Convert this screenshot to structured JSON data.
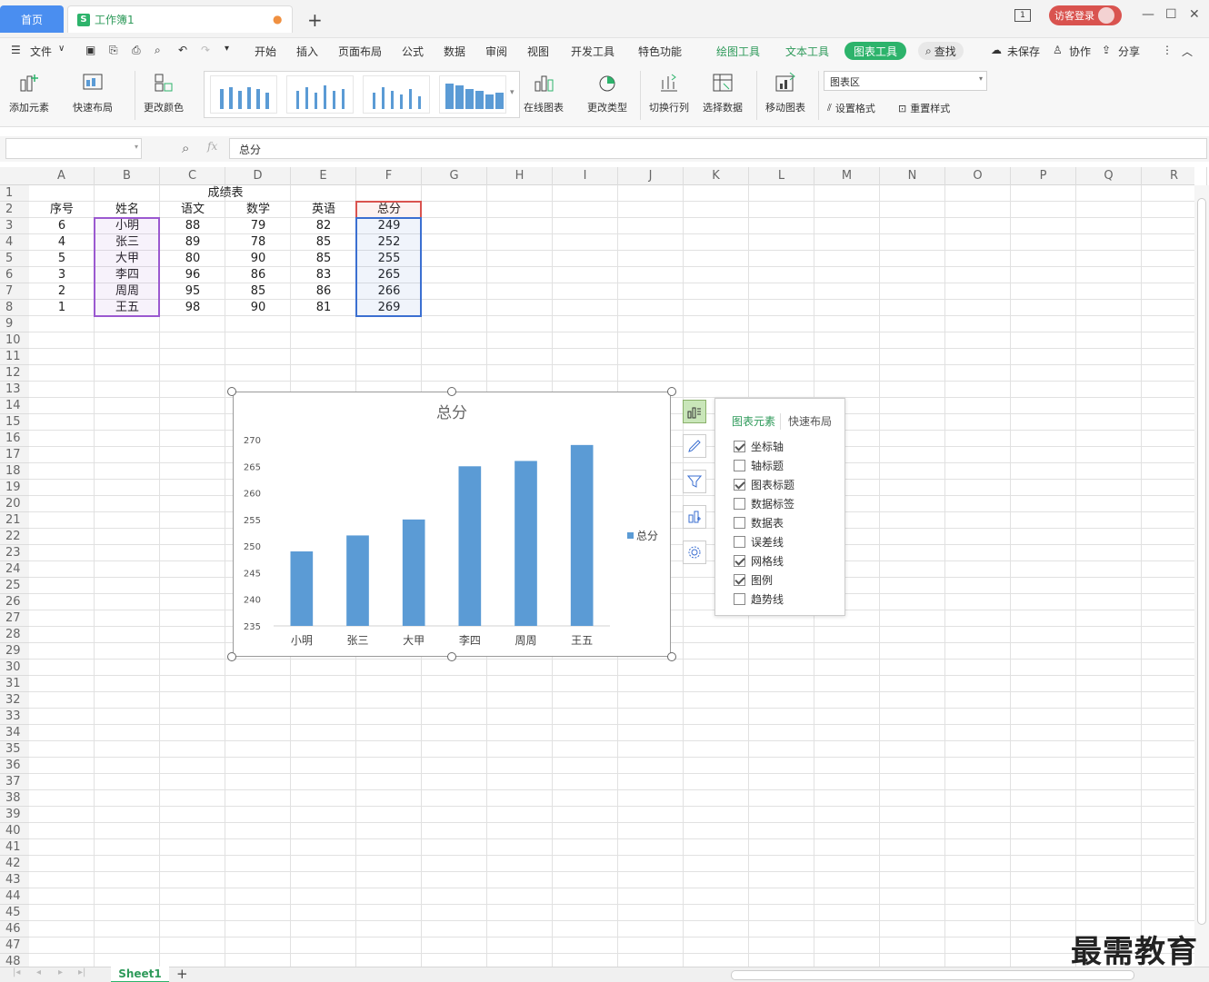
{
  "titlebar": {
    "home_tab": "首页",
    "doc_tab": "工作簿1",
    "doc_icon": "S",
    "modified_dot": "●",
    "new_tab": "+",
    "page_badge": "1",
    "login": "访客登录"
  },
  "menu": {
    "file": "文件",
    "items": [
      "开始",
      "插入",
      "页面布局",
      "公式",
      "数据",
      "审阅",
      "视图",
      "开发工具",
      "特色功能"
    ],
    "draw_tools": "绘图工具",
    "text_tools": "文本工具",
    "chart_tools": "图表工具",
    "search": "查找",
    "unsaved": "未保存",
    "collab": "协作",
    "share": "分享"
  },
  "ribbon": {
    "add_element": "添加元素",
    "quick_layout": "快速布局",
    "change_color": "更改颜色",
    "online_chart": "在线图表",
    "change_type": "更改类型",
    "switch_rowcol": "切换行列",
    "select_data": "选择数据",
    "move_chart": "移动图表",
    "area_select": "图表区",
    "set_format": "设置格式",
    "reset_style": "重置样式"
  },
  "formula": {
    "name_box": "",
    "fx": "fx",
    "value": "总分"
  },
  "columns": [
    "A",
    "B",
    "C",
    "D",
    "E",
    "F",
    "G",
    "H",
    "I",
    "J",
    "K",
    "L",
    "M",
    "N",
    "O",
    "P",
    "Q",
    "R"
  ],
  "rows": [
    "1",
    "2",
    "3",
    "4",
    "5",
    "6",
    "7",
    "8",
    "9",
    "10",
    "11",
    "12",
    "13",
    "14",
    "15",
    "16",
    "17",
    "18",
    "19",
    "20",
    "21",
    "22",
    "23",
    "24",
    "25",
    "26",
    "27",
    "28",
    "29",
    "30",
    "31",
    "32",
    "33",
    "34",
    "35",
    "36",
    "37",
    "38",
    "39",
    "40",
    "41",
    "42",
    "43",
    "44",
    "45",
    "46",
    "47",
    "48"
  ],
  "table": {
    "title": "成绩表",
    "headers": [
      "序号",
      "姓名",
      "语文",
      "数学",
      "英语",
      "总分"
    ],
    "rows": [
      [
        "6",
        "小明",
        "88",
        "79",
        "82",
        "249"
      ],
      [
        "4",
        "张三",
        "89",
        "78",
        "85",
        "252"
      ],
      [
        "5",
        "大甲",
        "80",
        "90",
        "85",
        "255"
      ],
      [
        "3",
        "李四",
        "96",
        "86",
        "83",
        "265"
      ],
      [
        "2",
        "周周",
        "95",
        "85",
        "86",
        "266"
      ],
      [
        "1",
        "王五",
        "98",
        "90",
        "81",
        "269"
      ]
    ]
  },
  "chart_data": {
    "type": "bar",
    "title": "总分",
    "categories": [
      "小明",
      "张三",
      "大甲",
      "李四",
      "周周",
      "王五"
    ],
    "series": [
      {
        "name": "总分",
        "values": [
          249,
          252,
          255,
          265,
          266,
          269
        ],
        "color": "#5b9bd5"
      }
    ],
    "ylim": [
      235,
      270
    ],
    "yticks": [
      "270",
      "265",
      "260",
      "255",
      "250",
      "245",
      "240",
      "235"
    ],
    "grid": false,
    "legend": "right"
  },
  "panel": {
    "tab_elements": "图表元素",
    "tab_layout": "快速布局",
    "options": [
      {
        "label": "坐标轴",
        "checked": true
      },
      {
        "label": "轴标题",
        "checked": false
      },
      {
        "label": "图表标题",
        "checked": true
      },
      {
        "label": "数据标签",
        "checked": false
      },
      {
        "label": "数据表",
        "checked": false
      },
      {
        "label": "误差线",
        "checked": false
      },
      {
        "label": "网格线",
        "checked": true
      },
      {
        "label": "图例",
        "checked": true
      },
      {
        "label": "趋势线",
        "checked": false
      }
    ]
  },
  "sheet": {
    "tab": "Sheet1",
    "add": "+"
  },
  "watermark": "最需教育",
  "colors": {
    "accent": "#2db36b",
    "home_tab": "#4a8ef0",
    "login": "#d9534f",
    "bar": "#5b9bd5"
  }
}
